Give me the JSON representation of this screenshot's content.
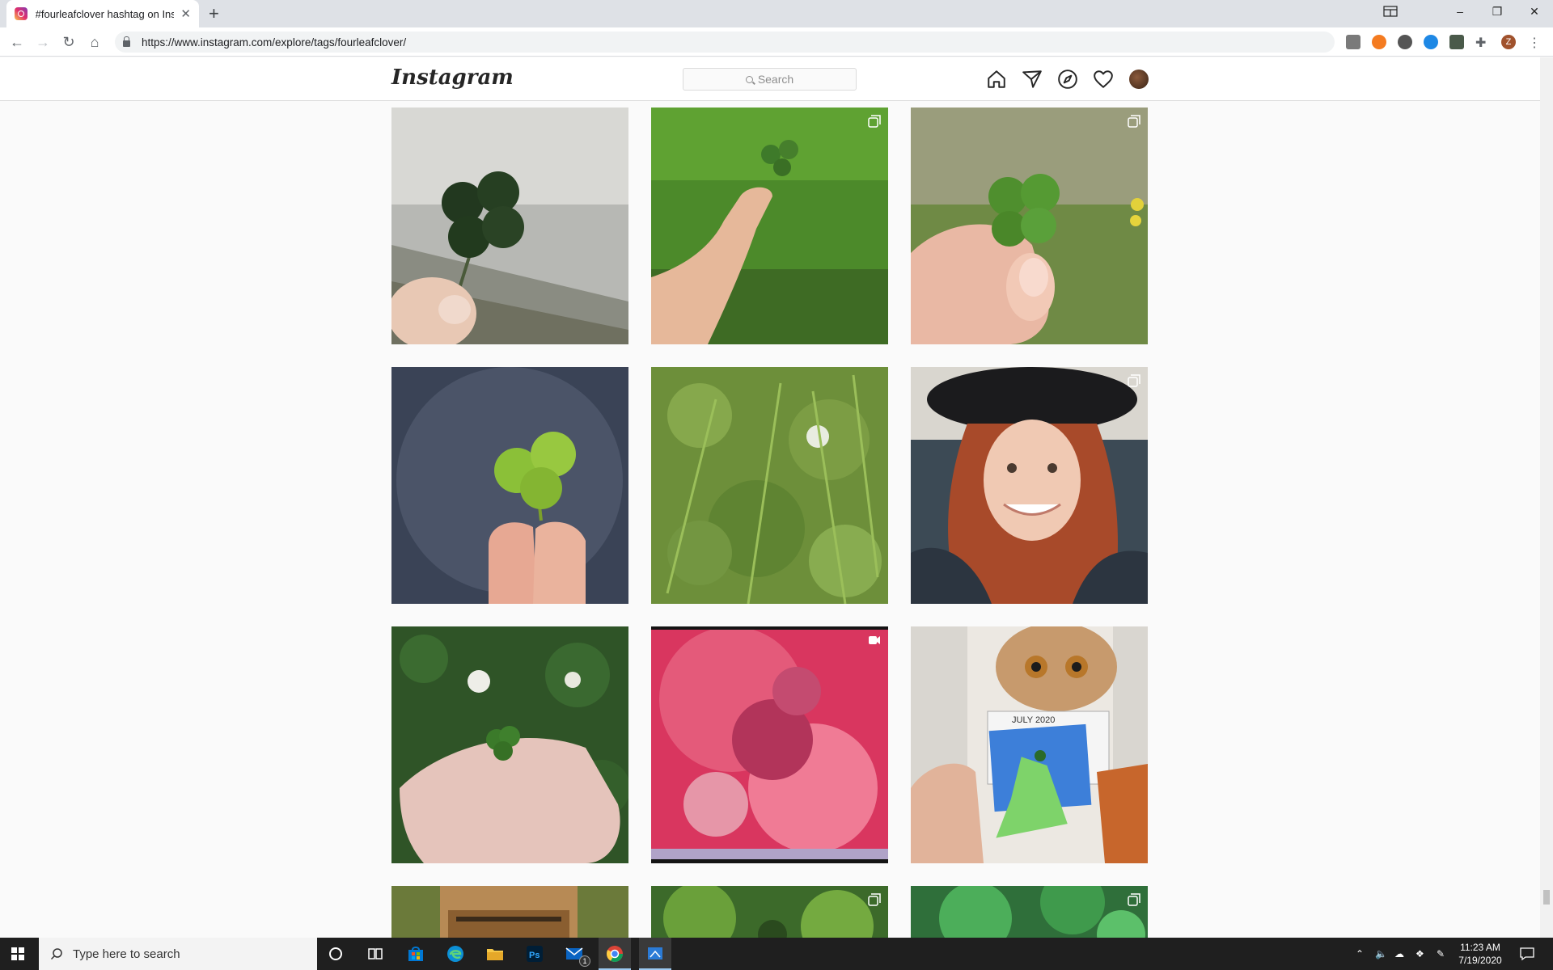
{
  "browser": {
    "tab_title": "#fourleafclover hashtag on Insta",
    "url": "https://www.instagram.com/explore/tags/fourleafclover/"
  },
  "instagram": {
    "logo": "Instagram",
    "search_placeholder": "Search",
    "nav_icons": [
      "home-icon",
      "direct-icon",
      "explore-icon",
      "activity-icon",
      "profile-avatar"
    ]
  },
  "grid": {
    "posts": [
      {
        "subject": "four-leaf clover held over stone",
        "badge": ""
      },
      {
        "subject": "clover held in grass field",
        "badge": "multiple-icon"
      },
      {
        "subject": "clover held by fingers",
        "badge": "multiple-icon"
      },
      {
        "subject": "clover on dark background",
        "badge": ""
      },
      {
        "subject": "clover patch in grass",
        "badge": ""
      },
      {
        "subject": "woman in black hat",
        "badge": "multiple-icon"
      },
      {
        "subject": "clover in palm",
        "badge": ""
      },
      {
        "subject": "pink red blurred video",
        "badge": "video-icon"
      },
      {
        "subject": "cat calendar July 2020 card",
        "badge": ""
      },
      {
        "subject": "jar",
        "badge": ""
      },
      {
        "subject": "clover closeup",
        "badge": "multiple-icon"
      },
      {
        "subject": "clover closeup green",
        "badge": "multiple-icon"
      }
    ]
  },
  "taskbar": {
    "search_placeholder": "Type here to search",
    "time": "11:23 AM",
    "date": "7/19/2020",
    "mail_badge": "1"
  },
  "colors": {
    "ig_border": "#dbdbdb",
    "chrome_tabbar": "#dee1e6",
    "taskbar": "#1f1f1f"
  }
}
